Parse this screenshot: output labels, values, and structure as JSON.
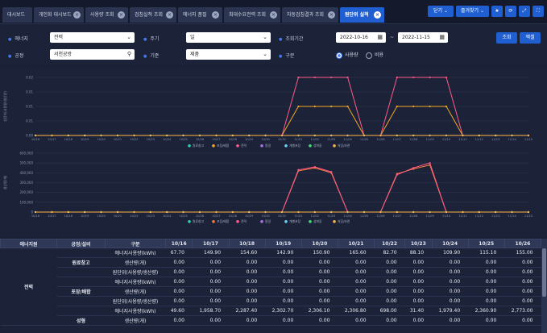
{
  "tabs": [
    {
      "label": "대시보드",
      "closable": false
    },
    {
      "label": "개인화 대시보드",
      "closable": true
    },
    {
      "label": "사용량 조회",
      "closable": true
    },
    {
      "label": "검침실적 조회",
      "closable": true
    },
    {
      "label": "에너지 품질",
      "closable": true
    },
    {
      "label": "최대수요전력 조회",
      "closable": true
    },
    {
      "label": "자동검침결과 조회",
      "closable": true
    },
    {
      "label": "원단위 실적",
      "closable": true,
      "active": true
    }
  ],
  "toolbar": {
    "close_label": "닫기",
    "favorite_label": "즐겨찾기",
    "star_icon": "★",
    "refresh_icon": "⟳",
    "expand_icon": "⤢",
    "fullscreen_icon": "⛶"
  },
  "filters": {
    "energy_label": "에너지",
    "energy_value": "전력",
    "cycle_label": "주기",
    "cycle_value": "일",
    "period_label": "조회기간",
    "date_from": "2022-10-16",
    "date_sep": "~",
    "date_to": "2022-11-15",
    "process_label": "공정",
    "process_value": "서천공방",
    "basis_label": "기준",
    "basis_value": "제품",
    "division_label": "구분",
    "radio_usage": "사용량",
    "radio_cost": "비용",
    "search_button": "조회",
    "excel_button": "엑셀"
  },
  "chart_data": [
    {
      "type": "line",
      "ylabel": "원단위(사용량/생산량)",
      "y_ticks": [
        "0.00",
        "0.01",
        "0.01",
        "0.01",
        "0.02"
      ],
      "ylim": [
        0,
        0.02
      ],
      "x": [
        "10/16",
        "10/17",
        "10/18",
        "10/19",
        "10/20",
        "10/21",
        "10/22",
        "10/23",
        "10/24",
        "10/25",
        "10/26",
        "10/27",
        "10/28",
        "10/29",
        "10/30",
        "10/31",
        "11/01",
        "11/02",
        "11/03",
        "11/04",
        "11/05",
        "11/06",
        "11/07",
        "11/08",
        "11/09",
        "11/10",
        "11/11",
        "11/12",
        "11/13",
        "11/14",
        "11/15"
      ],
      "series": [
        {
          "name": "원료창고",
          "color": "#2bd4b4",
          "values": [
            0,
            0,
            0,
            0,
            0,
            0,
            0,
            0,
            0,
            0,
            0,
            0,
            0,
            0,
            0,
            0,
            0,
            0,
            0,
            0,
            0,
            0,
            0,
            0,
            0,
            0,
            0,
            0,
            0,
            0,
            0
          ]
        },
        {
          "name": "포장/배합",
          "color": "#f5a623",
          "values": [
            0,
            0,
            0,
            0,
            0,
            0,
            0,
            0,
            0,
            0,
            0,
            0,
            0,
            0,
            0,
            0,
            0.01,
            0.01,
            0.01,
            0.01,
            0,
            0,
            0.01,
            0.01,
            0.01,
            0.01,
            0,
            0,
            0,
            0,
            0
          ]
        },
        {
          "name": "전력",
          "color": "#ff5a8a",
          "values": [
            0,
            0,
            0,
            0,
            0,
            0,
            0,
            0,
            0,
            0,
            0,
            0,
            0,
            0,
            0,
            0,
            0.02,
            0.02,
            0.02,
            0.02,
            0,
            0,
            0.02,
            0.02,
            0.02,
            0.02,
            0,
            0,
            0,
            0,
            0
          ]
        },
        {
          "name": "용경",
          "color": "#b070e8",
          "values": [
            0,
            0,
            0,
            0,
            0,
            0,
            0,
            0,
            0,
            0,
            0,
            0,
            0,
            0,
            0,
            0,
            0,
            0,
            0,
            0,
            0,
            0,
            0,
            0,
            0,
            0,
            0,
            0,
            0,
            0,
            0
          ]
        },
        {
          "name": "개별포장",
          "color": "#6ad0ff",
          "values": [
            0,
            0,
            0,
            0,
            0,
            0,
            0,
            0,
            0,
            0,
            0,
            0,
            0,
            0,
            0,
            0,
            0,
            0,
            0,
            0,
            0,
            0,
            0,
            0,
            0,
            0,
            0,
            0,
            0,
            0,
            0
          ]
        },
        {
          "name": "성화동",
          "color": "#3ee07a",
          "values": [
            0,
            0,
            0,
            0,
            0,
            0,
            0,
            0,
            0,
            0,
            0,
            0,
            0,
            0,
            0,
            0,
            0,
            0,
            0,
            0,
            0,
            0,
            0,
            0,
            0,
            0,
            0,
            0,
            0,
            0,
            0
          ]
        },
        {
          "name": "저장/보관",
          "color": "#ffb347",
          "values": [
            0,
            0,
            0,
            0,
            0,
            0,
            0,
            0,
            0,
            0,
            0,
            0,
            0,
            0,
            0,
            0,
            0,
            0,
            0,
            0,
            0,
            0,
            0,
            0,
            0,
            0,
            0,
            0,
            0,
            0,
            0
          ]
        }
      ]
    },
    {
      "type": "line",
      "ylabel": "생산량(개)",
      "y_ticks": [
        "0",
        "100,000",
        "200,000",
        "300,000",
        "400,000",
        "500,000",
        "600,000"
      ],
      "ylim": [
        0,
        600000
      ],
      "x": [
        "10/16",
        "10/17",
        "10/18",
        "10/19",
        "10/20",
        "10/21",
        "10/22",
        "10/23",
        "10/24",
        "10/25",
        "10/26",
        "10/27",
        "10/28",
        "10/29",
        "10/30",
        "10/31",
        "11/01",
        "11/02",
        "11/03",
        "11/04",
        "11/05",
        "11/06",
        "11/07",
        "11/08",
        "11/09",
        "11/10",
        "11/11",
        "11/12",
        "11/13",
        "11/14",
        "11/15"
      ],
      "series": [
        {
          "name": "원료창고",
          "color": "#2bd4b4",
          "values": [
            0,
            0,
            0,
            0,
            0,
            0,
            0,
            0,
            0,
            0,
            0,
            0,
            0,
            0,
            0,
            0,
            0,
            0,
            0,
            0,
            0,
            0,
            0,
            0,
            0,
            0,
            0,
            0,
            0,
            0,
            0
          ]
        },
        {
          "name": "포장/배합",
          "color": "#ff7a3a",
          "values": [
            0,
            0,
            0,
            0,
            0,
            0,
            0,
            0,
            0,
            0,
            0,
            0,
            0,
            0,
            0,
            0,
            420000,
            450000,
            400000,
            0,
            0,
            0,
            390000,
            440000,
            480000,
            0,
            0,
            0,
            0,
            0,
            0
          ]
        },
        {
          "name": "전력",
          "color": "#ff5a8a",
          "values": [
            0,
            0,
            0,
            0,
            0,
            0,
            0,
            0,
            0,
            0,
            0,
            0,
            0,
            0,
            0,
            0,
            430000,
            460000,
            410000,
            0,
            0,
            0,
            380000,
            450000,
            500000,
            0,
            0,
            0,
            0,
            0,
            0
          ]
        },
        {
          "name": "용경",
          "color": "#b070e8",
          "values": [
            0,
            0,
            0,
            0,
            0,
            0,
            0,
            0,
            0,
            0,
            0,
            0,
            0,
            0,
            0,
            0,
            0,
            0,
            0,
            0,
            0,
            0,
            0,
            0,
            0,
            0,
            0,
            0,
            0,
            0,
            0
          ]
        },
        {
          "name": "개별포장",
          "color": "#6ad0ff",
          "values": [
            0,
            0,
            0,
            0,
            0,
            0,
            0,
            0,
            0,
            0,
            0,
            0,
            0,
            0,
            0,
            0,
            0,
            0,
            0,
            0,
            0,
            0,
            0,
            0,
            0,
            0,
            0,
            0,
            0,
            0,
            0
          ]
        },
        {
          "name": "성화동",
          "color": "#3ee07a",
          "values": [
            0,
            0,
            0,
            0,
            0,
            0,
            0,
            0,
            0,
            0,
            0,
            0,
            0,
            0,
            0,
            0,
            0,
            0,
            0,
            0,
            0,
            0,
            0,
            0,
            0,
            0,
            0,
            0,
            0,
            0,
            0
          ]
        },
        {
          "name": "저장/보관",
          "color": "#ffb347",
          "values": [
            0,
            0,
            0,
            0,
            0,
            0,
            0,
            0,
            0,
            0,
            0,
            0,
            0,
            0,
            0,
            0,
            0,
            0,
            0,
            0,
            0,
            0,
            0,
            0,
            0,
            0,
            0,
            0,
            0,
            0,
            0
          ]
        }
      ]
    }
  ],
  "table": {
    "headers": [
      "에너지원",
      "공정/설비",
      "구분",
      "10/16",
      "10/17",
      "10/18",
      "10/19",
      "10/20",
      "10/21",
      "10/22",
      "10/23",
      "10/24",
      "10/25",
      "10/26"
    ],
    "energy_cell": "전력",
    "rows": [
      {
        "group": "",
        "kind": "에너지사용량(kWh)",
        "values": [
          "67.70",
          "149.90",
          "154.60",
          "142.90",
          "150.90",
          "165.60",
          "82.70",
          "88.10",
          "109.90",
          "115.10",
          "155.00"
        ]
      },
      {
        "group": "원료창고",
        "kind": "생산량(개)",
        "values": [
          "0.00",
          "0.00",
          "0.00",
          "0.00",
          "0.00",
          "0.00",
          "0.00",
          "0.00",
          "0.00",
          "0.00",
          "0.00"
        ]
      },
      {
        "group": "",
        "kind": "원단위(사용량/생산량)",
        "values": [
          "0.00",
          "0.00",
          "0.00",
          "0.00",
          "0.00",
          "0.00",
          "0.00",
          "0.00",
          "0.00",
          "0.00",
          "0.00"
        ]
      },
      {
        "group": "",
        "kind": "에너지사용량(kWh)",
        "values": [
          "0.00",
          "0.00",
          "0.00",
          "0.00",
          "0.00",
          "0.00",
          "0.00",
          "0.00",
          "0.00",
          "0.00",
          "0.00"
        ]
      },
      {
        "group": "포장/배합",
        "kind": "생산량(개)",
        "values": [
          "0.00",
          "0.00",
          "0.00",
          "0.00",
          "0.00",
          "0.00",
          "0.00",
          "0.00",
          "0.00",
          "0.00",
          "0.00"
        ]
      },
      {
        "group": "",
        "kind": "원단위(사용량/생산량)",
        "values": [
          "0.00",
          "0.00",
          "0.00",
          "0.00",
          "0.00",
          "0.00",
          "0.00",
          "0.00",
          "0.00",
          "0.00",
          "0.00"
        ]
      },
      {
        "group": "",
        "kind": "에너지사용량(kWh)",
        "values": [
          "49.60",
          "1,958.70",
          "2,287.40",
          "2,302.70",
          "2,306.10",
          "2,306.80",
          "698.00",
          "31.40",
          "1,979.40",
          "2,360.90",
          "2,773.00"
        ]
      },
      {
        "group": "성형",
        "kind": "생산량(개)",
        "values": [
          "0.00",
          "0.00",
          "0.00",
          "0.00",
          "0.00",
          "0.00",
          "0.00",
          "0.00",
          "0.00",
          "0.00",
          "0.00"
        ]
      }
    ]
  }
}
